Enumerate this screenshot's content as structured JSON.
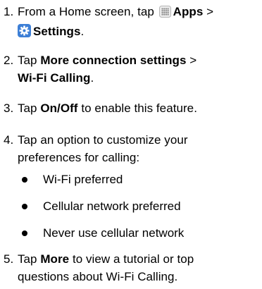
{
  "steps": [
    {
      "num": "1.",
      "t1": "From a Home screen, tap",
      "apps": "Apps",
      "sep": ">",
      "settings": "Settings",
      "dot": "."
    },
    {
      "num": "2.",
      "t1": "Tap",
      "more_conn": "More connection settings",
      "sep": ">",
      "wifi_calling": "Wi-Fi Calling",
      "dot": "."
    },
    {
      "num": "3.",
      "t1": "Tap",
      "onoff": "On/Off",
      "t2": "to enable this feature."
    },
    {
      "num": "4.",
      "text": "Tap an option to customize your preferences for calling:"
    },
    {
      "num": "5.",
      "t1": "Tap",
      "more": "More",
      "t2": "to view a tutorial or top questions about Wi-Fi Calling."
    }
  ],
  "bullets": [
    "Wi-Fi preferred",
    "Cellular network preferred",
    "Never use cellular network"
  ],
  "icons": {
    "apps": "apps-grid-icon",
    "settings": "settings-gear-icon",
    "settings_color": "#3d7fd6"
  }
}
